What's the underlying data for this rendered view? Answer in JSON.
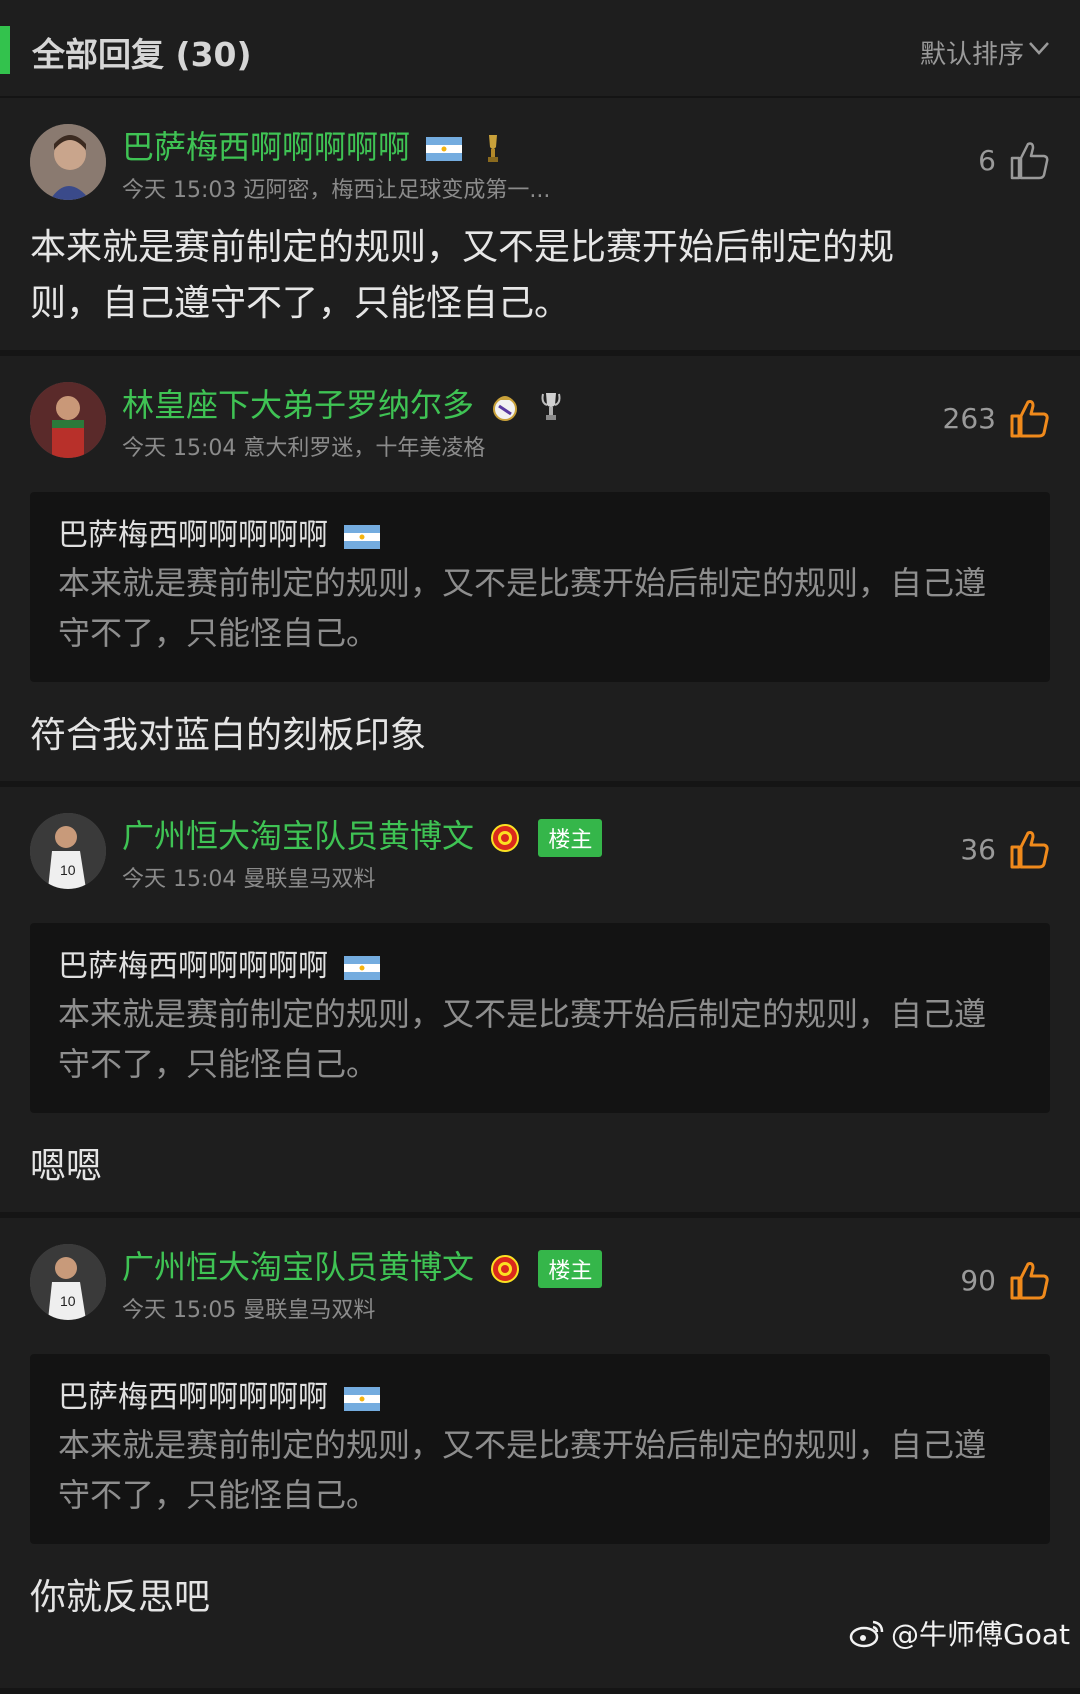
{
  "header": {
    "title": "全部回复 (30)",
    "sort_label": "默认排序"
  },
  "comments": [
    {
      "name": "巴萨梅西啊啊啊啊啊",
      "meta": "今天 15:03 迈阿密，梅西让足球变成第一...",
      "likes": "6",
      "body": "本来就是赛前制定的规则，又不是比赛开始后制定的规则，自己遵守不了，只能怪自己。"
    },
    {
      "name": "林皇座下大弟子罗纳尔多",
      "meta": "今天 15:04 意大利罗迷，十年美凌格",
      "likes": "263",
      "quote_name": "巴萨梅西啊啊啊啊啊",
      "quote_text": "本来就是赛前制定的规则，又不是比赛开始后制定的规则，自己遵守不了，只能怪自己。",
      "reply": "符合我对蓝白的刻板印象"
    },
    {
      "name": "广州恒大淘宝队员黄博文",
      "owner_badge": "楼主",
      "meta": "今天 15:04 曼联皇马双料",
      "likes": "36",
      "quote_name": "巴萨梅西啊啊啊啊啊",
      "quote_text": "本来就是赛前制定的规则，又不是比赛开始后制定的规则，自己遵守不了，只能怪自己。",
      "reply": "嗯嗯"
    },
    {
      "name": "广州恒大淘宝队员黄博文",
      "owner_badge": "楼主",
      "meta": "今天 15:05 曼联皇马双料",
      "likes": "90",
      "quote_name": "巴萨梅西啊啊啊啊啊",
      "quote_text": "本来就是赛前制定的规则，又不是比赛开始后制定的规则，自己遵守不了，只能怪自己。",
      "reply": "你就反思吧"
    }
  ],
  "watermark": "@牛师傅Goat",
  "colors": {
    "accent": "#33c24d",
    "like_active": "#f08a1c",
    "background": "#1e1e1e"
  },
  "icons": [
    "thumbs-up-icon",
    "argentina-flag-icon",
    "trophy-icon",
    "real-madrid-crest-icon",
    "manchester-united-crest-icon",
    "weibo-icon",
    "chevron-down-icon"
  ]
}
